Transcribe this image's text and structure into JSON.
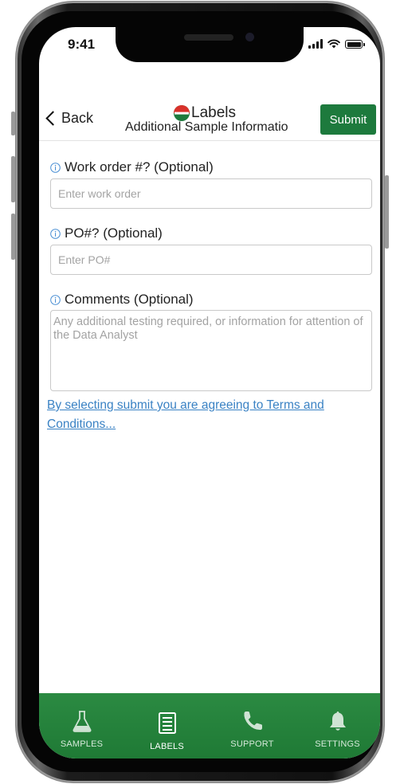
{
  "status_bar": {
    "time": "9:41"
  },
  "nav": {
    "back_label": "Back",
    "logo_text": "Labels",
    "subtitle": "Additional Sample Informatio",
    "submit_label": "Submit"
  },
  "form": {
    "work_order": {
      "label": "Work order #? (Optional)",
      "placeholder": "Enter work order",
      "value": ""
    },
    "po": {
      "label": "PO#? (Optional)",
      "placeholder": "Enter PO#",
      "value": ""
    },
    "comments": {
      "label": "Comments (Optional)",
      "placeholder": "Any additional testing required, or information for attention of the Data Analyst",
      "value": ""
    },
    "terms_link": "By selecting submit you are agreeing to Terms and Conditions..."
  },
  "tabs": [
    {
      "label": "SAMPLES",
      "icon": "flask-icon",
      "active": false
    },
    {
      "label": "LABELS",
      "icon": "labels-list-icon",
      "active": true
    },
    {
      "label": "SUPPORT",
      "icon": "phone-icon",
      "active": false
    },
    {
      "label": "SETTINGS",
      "icon": "bell-icon",
      "active": false
    }
  ],
  "colors": {
    "brand_green": "#1d7a3d",
    "link_blue": "#3a82c4",
    "info_blue": "#4a8fd4",
    "tab_label": "#d6e9da",
    "logo_red": "#d9312b"
  }
}
